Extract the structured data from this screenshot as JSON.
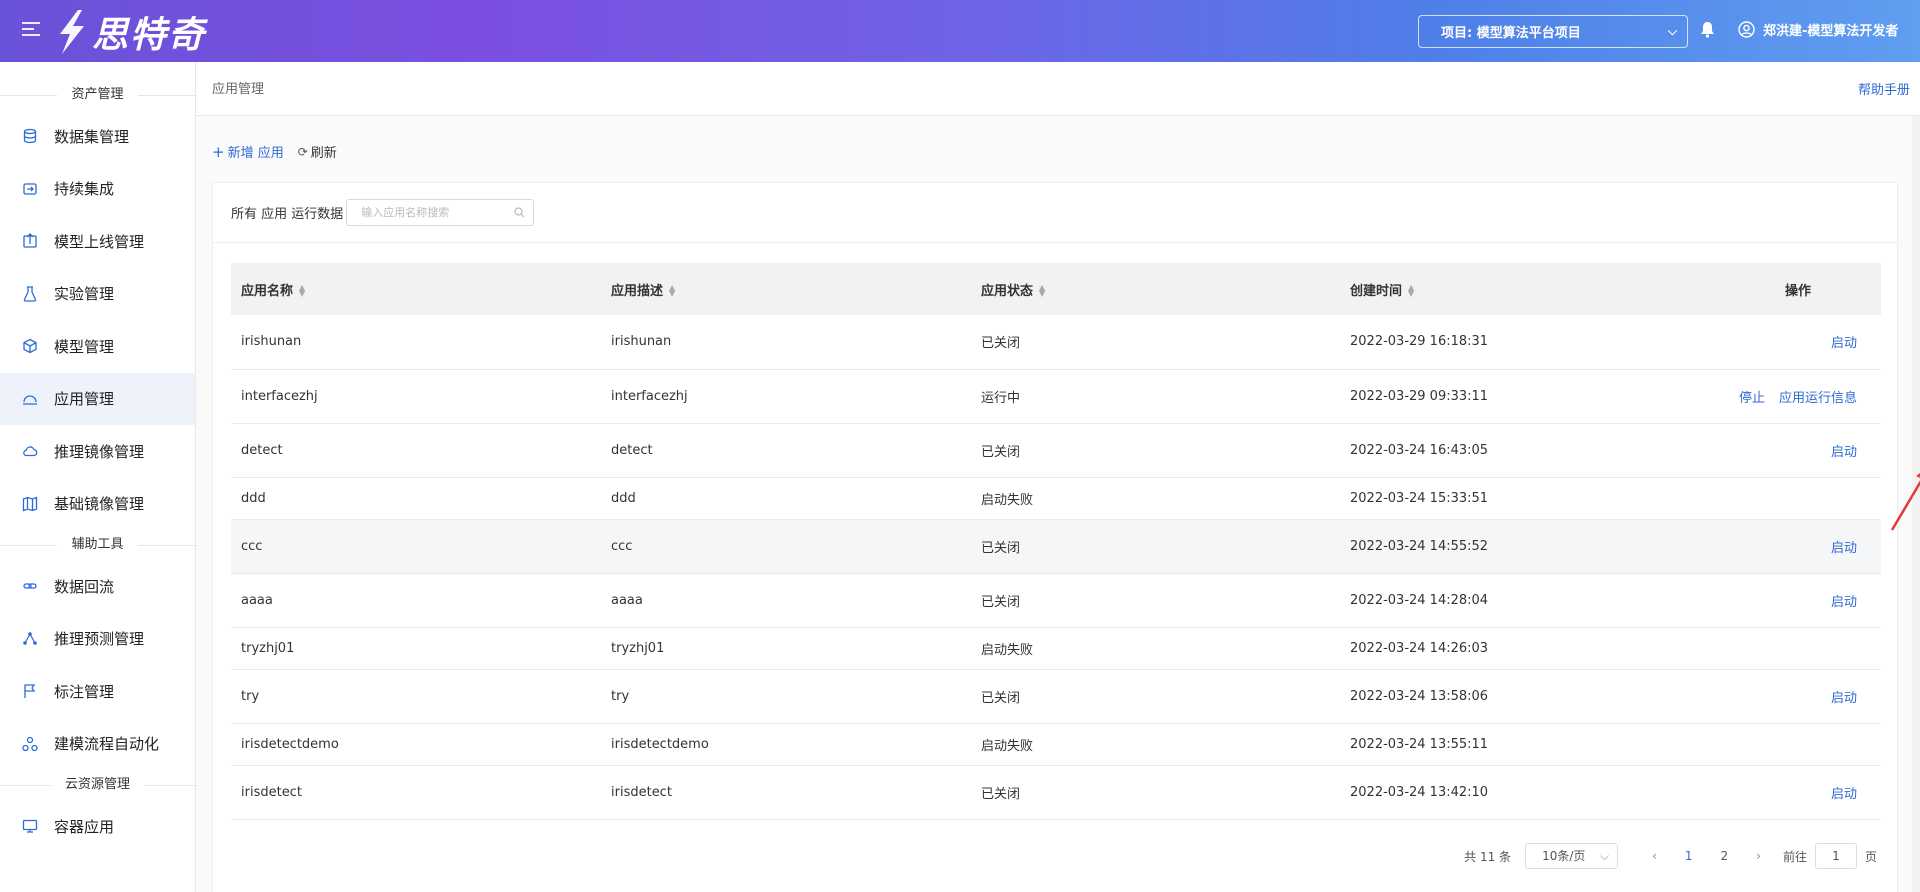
{
  "header": {
    "logo_text": "思特奇",
    "project_label": "项目: 模型算法平台项目",
    "user_name": "郑洪建-模型算法开发者"
  },
  "sidebar": {
    "groups": [
      {
        "title": "资产管理"
      },
      {
        "title": "辅助工具"
      },
      {
        "title": "云资源管理"
      }
    ],
    "items": [
      {
        "label": "数据集管理",
        "icon": "database-icon"
      },
      {
        "label": "持续集成",
        "icon": "integration-icon"
      },
      {
        "label": "模型上线管理",
        "icon": "upload-icon"
      },
      {
        "label": "实验管理",
        "icon": "flask-icon"
      },
      {
        "label": "模型管理",
        "icon": "cube-icon"
      },
      {
        "label": "应用管理",
        "icon": "app-icon"
      },
      {
        "label": "推理镜像管理",
        "icon": "cloud-icon"
      },
      {
        "label": "基础镜像管理",
        "icon": "map-icon"
      },
      {
        "label": "数据回流",
        "icon": "link-icon"
      },
      {
        "label": "推理预测管理",
        "icon": "nodes-icon"
      },
      {
        "label": "标注管理",
        "icon": "flag-icon"
      },
      {
        "label": "建模流程自动化",
        "icon": "workflow-icon"
      },
      {
        "label": "容器应用",
        "icon": "monitor-icon"
      }
    ]
  },
  "page": {
    "breadcrumb": "应用管理",
    "help_label": "帮助手册",
    "add_label": "新增 应用",
    "refresh_label": "刷新",
    "filter_label": "所有 应用 运行数据",
    "search_placeholder": "输入应用名称搜索"
  },
  "table": {
    "headers": [
      "应用名称",
      "应用描述",
      "应用状态",
      "创建时间",
      "操作"
    ],
    "rows": [
      {
        "name": "irishunan",
        "desc": "irishunan",
        "status": "已关闭",
        "time": "2022-03-29 16:18:31",
        "op1": "",
        "op2": "启动"
      },
      {
        "name": "interfacezhj",
        "desc": "interfacezhj",
        "status": "运行中",
        "time": "2022-03-29 09:33:11",
        "op1": "停止",
        "op2": "应用运行信息"
      },
      {
        "name": "detect",
        "desc": "detect",
        "status": "已关闭",
        "time": "2022-03-24 16:43:05",
        "op1": "",
        "op2": "启动"
      },
      {
        "name": "ddd",
        "desc": "ddd",
        "status": "启动失败",
        "time": "2022-03-24 15:33:51",
        "op1": "",
        "op2": ""
      },
      {
        "name": "ccc",
        "desc": "ccc",
        "status": "已关闭",
        "time": "2022-03-24 14:55:52",
        "op1": "",
        "op2": "启动"
      },
      {
        "name": "aaaa",
        "desc": "aaaa",
        "status": "已关闭",
        "time": "2022-03-24 14:28:04",
        "op1": "",
        "op2": "启动"
      },
      {
        "name": "tryzhj01",
        "desc": "tryzhj01",
        "status": "启动失败",
        "time": "2022-03-24 14:26:03",
        "op1": "",
        "op2": ""
      },
      {
        "name": "try",
        "desc": "try",
        "status": "已关闭",
        "time": "2022-03-24 13:58:06",
        "op1": "",
        "op2": "启动"
      },
      {
        "name": "irisdetectdemo",
        "desc": "irisdetectdemo",
        "status": "启动失败",
        "time": "2022-03-24 13:55:11",
        "op1": "",
        "op2": ""
      },
      {
        "name": "irisdetect",
        "desc": "irisdetect",
        "status": "已关闭",
        "time": "2022-03-24 13:42:10",
        "op1": "",
        "op2": "启动"
      }
    ]
  },
  "pager": {
    "total": "共 11 条",
    "page_size": "10条/页",
    "pages": [
      "1",
      "2"
    ],
    "goto_label": "前往",
    "goto_value": "1",
    "page_suffix": "页"
  },
  "colors": {
    "accent": "#2d6ad6",
    "header_start": "#6a52d8",
    "header_end": "#5f9ef0",
    "annotation_arrow": "#e53935"
  }
}
